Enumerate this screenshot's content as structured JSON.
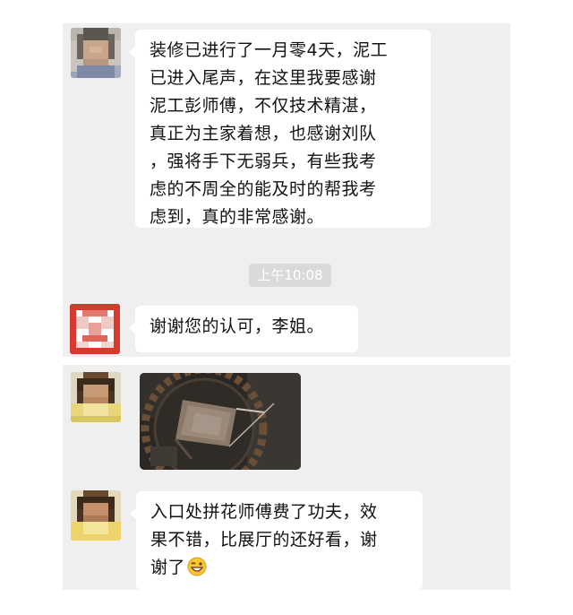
{
  "chat": {
    "message1": {
      "lines": [
        "装修已进行了一月零4天，泥工",
        "已进入尾声，在这里我要感谢",
        "泥工彭师傅，不仅技术精湛，",
        "真正为主家着想，也感谢刘队",
        "，强将手下无弱兵，有些我考",
        "虑的不周全的能及时的帮我考",
        "虑到，真的非常感谢。"
      ]
    },
    "timestamp": "上午10:08",
    "message2": {
      "text": "谢谢您的认可，李姐。"
    },
    "message3": {
      "kind": "image"
    },
    "message4": {
      "lines": [
        "入口处拼花师傅费了功夫，效",
        "果不错，比展厅的还好看，谢",
        "谢了"
      ],
      "emoji": "grin-wink-emoji"
    }
  }
}
